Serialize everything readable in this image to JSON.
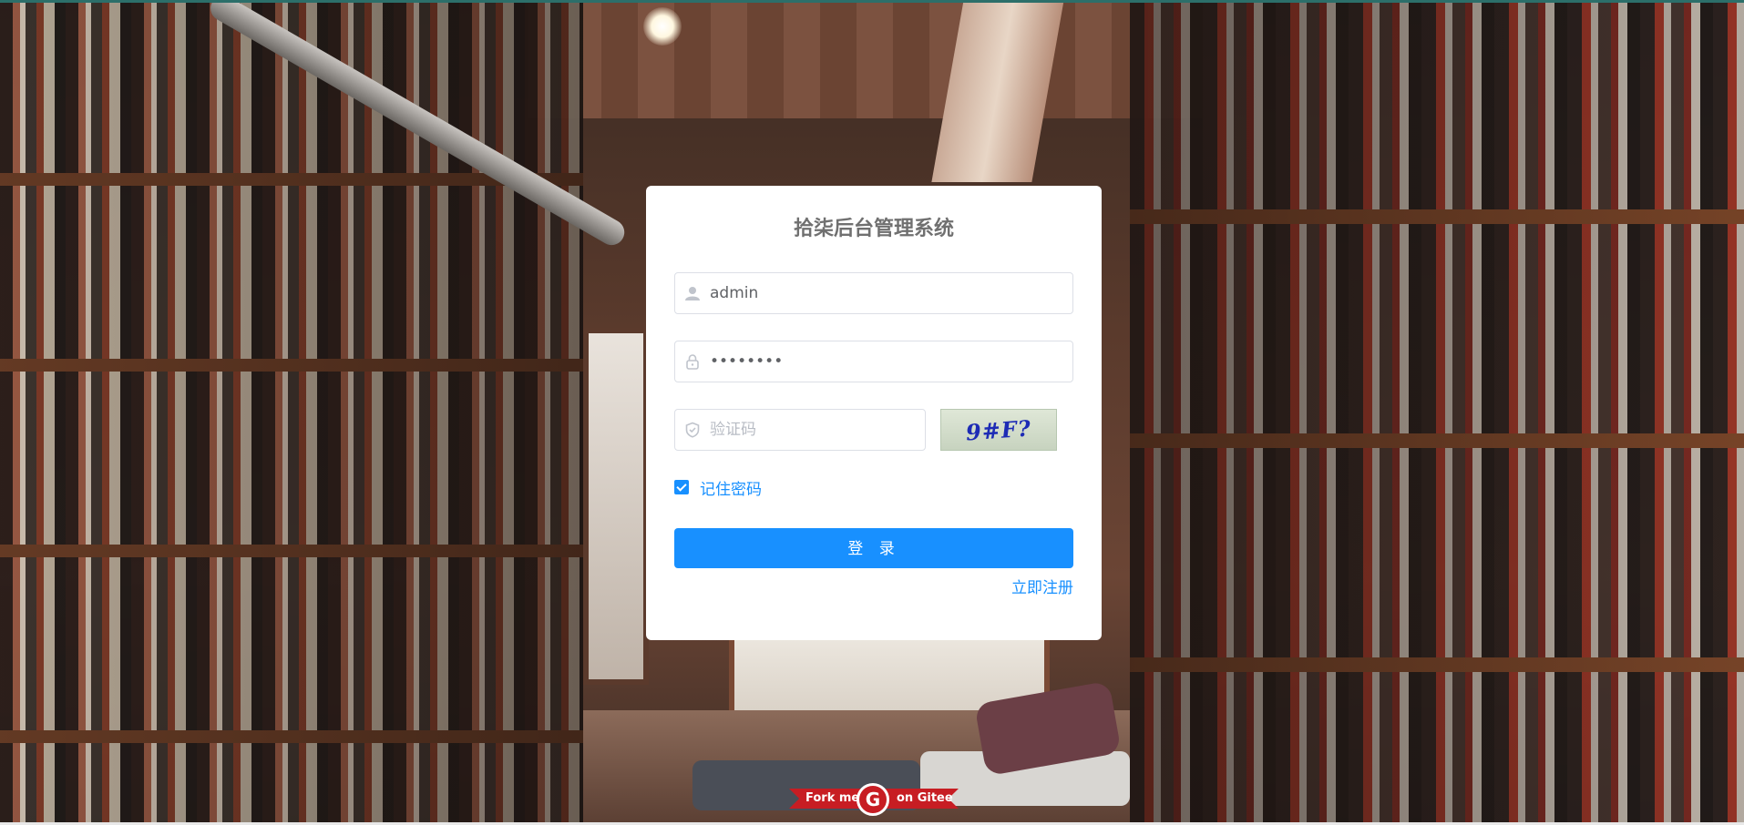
{
  "login": {
    "title": "拾柒后台管理系统",
    "username": {
      "value": "admin",
      "icon": "user-icon"
    },
    "password": {
      "value": "••••••••",
      "icon": "lock-icon"
    },
    "captcha": {
      "placeholder": "验证码",
      "icon": "shield-icon",
      "image_text": "9#F?"
    },
    "remember": {
      "label": "记住密码",
      "checked": true
    },
    "submit_label": "登 录",
    "register_label": "立即注册"
  },
  "ribbon": {
    "left_text": "Fork me",
    "logo_text": "G",
    "right_text": "on Gitee",
    "icon": "gitee-logo-icon"
  },
  "colors": {
    "primary": "#1890ff",
    "gitee_red": "#c71d23",
    "title_gray": "#707070"
  }
}
